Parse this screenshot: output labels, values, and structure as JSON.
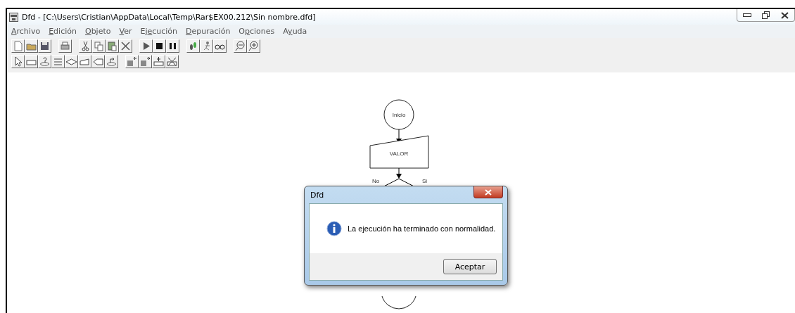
{
  "window": {
    "title": "Dfd - [C:\\Users\\Cristian\\AppData\\Local\\Temp\\Rar$EX00.212\\Sin nombre.dfd]"
  },
  "menu": [
    {
      "label": "Archivo"
    },
    {
      "label": "Edición"
    },
    {
      "label": "Objeto"
    },
    {
      "label": "Ver"
    },
    {
      "label": "Ejecución"
    },
    {
      "label": "Depuración"
    },
    {
      "label": "Opciones"
    },
    {
      "label": "Ayuda"
    }
  ],
  "flowchart": {
    "start": "Inicio",
    "input": "VALOR",
    "decision_no": "No",
    "decision_yes": "Si"
  },
  "dialog": {
    "title": "Dfd",
    "message": "La ejecución ha terminado con normalidad.",
    "button": "Aceptar"
  }
}
